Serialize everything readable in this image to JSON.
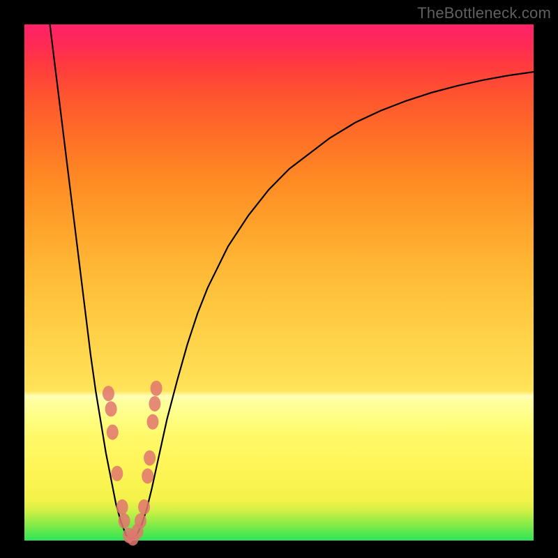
{
  "watermark": "TheBottleneck.com",
  "colors": {
    "curve_stroke": "#000000",
    "marker_fill": "#e0766f",
    "background_black": "#000000"
  },
  "chart_data": {
    "type": "line",
    "title": "",
    "xlabel": "",
    "ylabel": "",
    "xlim": [
      0,
      100
    ],
    "ylim": [
      0,
      100
    ],
    "series": [
      {
        "name": "bottleneck-curve",
        "x": [
          5,
          6,
          7,
          8,
          9,
          10,
          11,
          12,
          13,
          14,
          15,
          16,
          17,
          18,
          19,
          20,
          21,
          22,
          23,
          24,
          25,
          26,
          27,
          28,
          30,
          32,
          34,
          36,
          38,
          40,
          44,
          48,
          52,
          56,
          60,
          65,
          70,
          75,
          80,
          85,
          90,
          95,
          100
        ],
        "y": [
          100,
          92,
          84,
          76,
          68,
          60,
          52,
          44,
          36,
          29,
          23,
          17,
          12,
          7,
          3.5,
          1,
          0.3,
          1,
          3,
          6,
          10,
          14.5,
          19,
          23.5,
          31,
          38,
          44,
          49,
          53,
          57,
          63,
          68,
          72,
          75,
          78,
          81,
          83.3,
          85.2,
          86.8,
          88.1,
          89.2,
          90.1,
          90.8
        ]
      }
    ],
    "markers": {
      "name": "highlighted-points",
      "points": [
        {
          "x": 16.5,
          "y": 28.5
        },
        {
          "x": 17.0,
          "y": 25.5
        },
        {
          "x": 17.3,
          "y": 21.0
        },
        {
          "x": 18.2,
          "y": 13.0
        },
        {
          "x": 19.2,
          "y": 6.5
        },
        {
          "x": 19.6,
          "y": 3.8
        },
        {
          "x": 20.5,
          "y": 1.0
        },
        {
          "x": 21.3,
          "y": 0.5
        },
        {
          "x": 22.2,
          "y": 1.8
        },
        {
          "x": 22.8,
          "y": 3.8
        },
        {
          "x": 23.5,
          "y": 6.5
        },
        {
          "x": 24.2,
          "y": 12.5
        },
        {
          "x": 24.6,
          "y": 16.0
        },
        {
          "x": 25.2,
          "y": 23.0
        },
        {
          "x": 25.6,
          "y": 26.5
        },
        {
          "x": 25.9,
          "y": 29.5
        }
      ]
    }
  }
}
